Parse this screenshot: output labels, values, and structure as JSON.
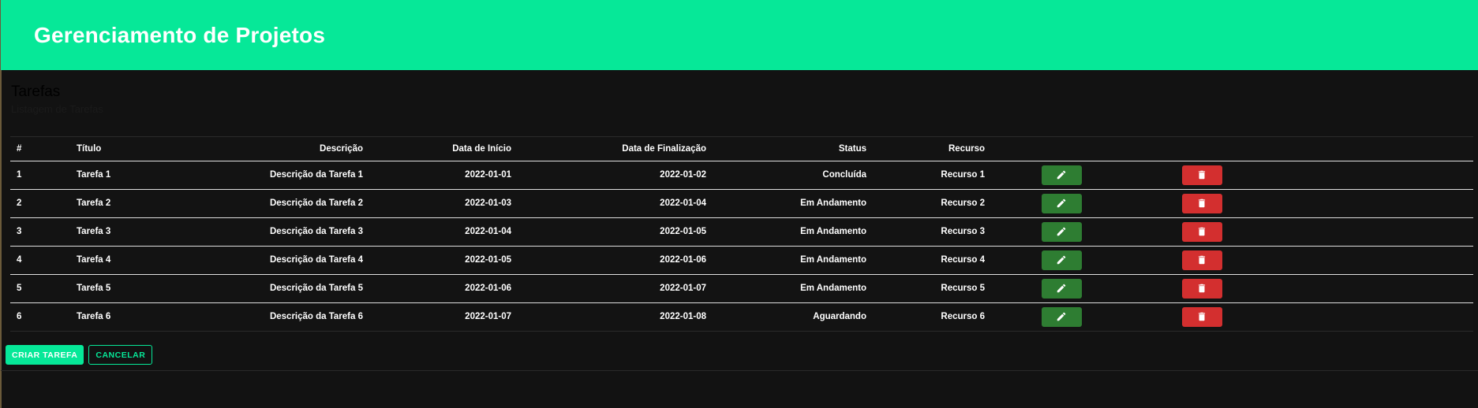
{
  "app": {
    "title": "Gerenciamento de Projetos"
  },
  "colors": {
    "accent": "#06e898",
    "edit": "#2e7d32",
    "delete": "#d32f2f",
    "background": "#121212"
  },
  "section": {
    "title": "Tarefas",
    "subtitle": "Listagem de Tarefas"
  },
  "table": {
    "headers": [
      "#",
      "Título",
      "Descrição",
      "Data de Início",
      "Data de Finalização",
      "Status",
      "Recurso"
    ],
    "rows": [
      {
        "id": "1",
        "titulo": "Tarefa 1",
        "descricao": "Descrição da Tarefa 1",
        "inicio": "2022-01-01",
        "fim": "2022-01-02",
        "status": "Concluída",
        "recurso": "Recurso 1"
      },
      {
        "id": "2",
        "titulo": "Tarefa 2",
        "descricao": "Descrição da Tarefa 2",
        "inicio": "2022-01-03",
        "fim": "2022-01-04",
        "status": "Em Andamento",
        "recurso": "Recurso 2"
      },
      {
        "id": "3",
        "titulo": "Tarefa 3",
        "descricao": "Descrição da Tarefa 3",
        "inicio": "2022-01-04",
        "fim": "2022-01-05",
        "status": "Em Andamento",
        "recurso": "Recurso 3"
      },
      {
        "id": "4",
        "titulo": "Tarefa 4",
        "descricao": "Descrição da Tarefa 4",
        "inicio": "2022-01-05",
        "fim": "2022-01-06",
        "status": "Em Andamento",
        "recurso": "Recurso 4"
      },
      {
        "id": "5",
        "titulo": "Tarefa 5",
        "descricao": "Descrição da Tarefa 5",
        "inicio": "2022-01-06",
        "fim": "2022-01-07",
        "status": "Em Andamento",
        "recurso": "Recurso 5"
      },
      {
        "id": "6",
        "titulo": "Tarefa 6",
        "descricao": "Descrição da Tarefa 6",
        "inicio": "2022-01-07",
        "fim": "2022-01-08",
        "status": "Aguardando",
        "recurso": "Recurso 6"
      }
    ],
    "row_icons": {
      "edit": "pencil-icon",
      "delete": "trash-icon"
    }
  },
  "actions": {
    "create_label": "CRIAR TAREFA",
    "cancel_label": "CANCELAR"
  }
}
